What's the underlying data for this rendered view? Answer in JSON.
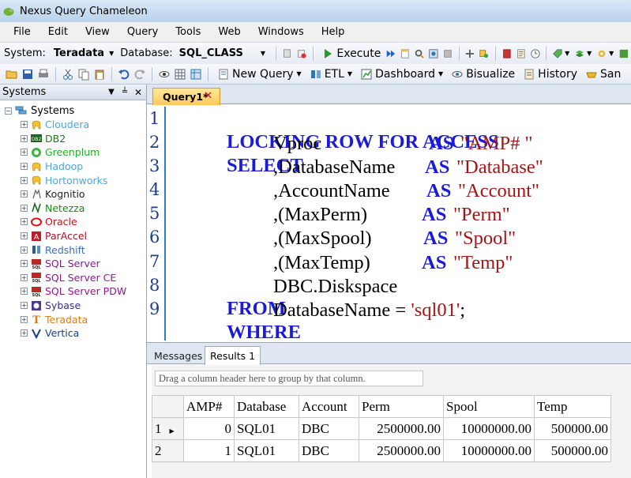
{
  "window": {
    "title": "Nexus Query Chameleon"
  },
  "menu": [
    "File",
    "Edit",
    "View",
    "Query",
    "Tools",
    "Web",
    "Windows",
    "Help"
  ],
  "toolbar1": {
    "system_label": "System:",
    "system_value": "Teradata",
    "database_label": "Database:",
    "database_value": "SQL_CLASS",
    "execute_label": "Execute"
  },
  "toolbar2": {
    "new_query_label": "New Query",
    "etl_label": "ETL",
    "dashboard_label": "Dashboard",
    "bisualize_label": "Bisualize",
    "history_label": "History",
    "san_label": "San"
  },
  "systems_panel": {
    "header": "Systems",
    "root": "Systems",
    "items": [
      {
        "label": "Cloudera",
        "color": "#4aa7d8",
        "icon": "elephant-icon"
      },
      {
        "label": "DB2",
        "color": "#1a7a1a",
        "icon": "db2-icon"
      },
      {
        "label": "Greenplum",
        "color": "#22b022",
        "icon": "greenplum-icon"
      },
      {
        "label": "Hadoop",
        "color": "#4aa7d8",
        "icon": "elephant-icon"
      },
      {
        "label": "Hortonworks",
        "color": "#4aa7d8",
        "icon": "elephant-icon"
      },
      {
        "label": "Kognitio",
        "color": "#222222",
        "icon": "kognitio-icon"
      },
      {
        "label": "Netezza",
        "color": "#1a8a1a",
        "icon": "netezza-icon"
      },
      {
        "label": "Oracle",
        "color": "#cc1111",
        "icon": "oracle-icon"
      },
      {
        "label": "ParAccel",
        "color": "#b01020",
        "icon": "paraccel-icon"
      },
      {
        "label": "Redshift",
        "color": "#3a6fb0",
        "icon": "redshift-icon"
      },
      {
        "label": "SQL Server",
        "color": "#8b1a8b",
        "icon": "sql-server-icon"
      },
      {
        "label": "SQL Server CE",
        "color": "#8b1a8b",
        "icon": "sql-server-icon"
      },
      {
        "label": "SQL Server PDW",
        "color": "#8b1a8b",
        "icon": "sql-server-icon"
      },
      {
        "label": "Sybase",
        "color": "#3a2a8a",
        "icon": "sybase-icon"
      },
      {
        "label": "Teradata",
        "color": "#e07a10",
        "icon": "teradata-icon"
      },
      {
        "label": "Vertica",
        "color": "#1a3a8a",
        "icon": "vertica-icon"
      }
    ]
  },
  "editor": {
    "tab_label": "Query1*",
    "tab_close": "✕",
    "line_numbers": [
      "1",
      "2",
      "3",
      "4",
      "5",
      "6",
      "7",
      "8",
      "9"
    ],
    "lines": {
      "l1_kw": "LOCKING ROW FOR ACCESS",
      "l2_kw": "SELECT",
      "l2_col": "Vproc",
      "l2_as": "AS",
      "l2_alias": "\"AMP# \"",
      "l3_col": ",DatabaseName",
      "l3_as": "AS",
      "l3_alias": "\"Database\"",
      "l4_col": ",AccountName",
      "l4_as": "AS",
      "l4_alias": "\"Account\"",
      "l5_col": ",(MaxPerm)",
      "l5_as": "AS",
      "l5_alias": "\"Perm\"",
      "l6_col": ",(MaxSpool)",
      "l6_as": "AS",
      "l6_alias": "\"Spool\"",
      "l7_col": ",(MaxTemp)",
      "l7_as": "AS",
      "l7_alias": "\"Temp\"",
      "l8_kw": "FROM",
      "l8_rest": "DBC.Diskspace",
      "l9_kw": "WHERE",
      "l9_rest": "DatabaseName = ",
      "l9_str": "'sql01'",
      "l9_end": ";"
    }
  },
  "results": {
    "tab_messages": "Messages",
    "tab_results": "Results 1",
    "group_hint": "Drag a column header here to group by that column.",
    "columns": [
      "AMP#",
      "Database",
      "Account",
      "Perm",
      "Spool",
      "Temp"
    ],
    "rows": [
      {
        "num": "1",
        "cells": [
          "0",
          "SQL01",
          "DBC",
          "2500000.00",
          "10000000.00",
          "500000.00"
        ]
      },
      {
        "num": "2",
        "cells": [
          "1",
          "SQL01",
          "DBC",
          "2500000.00",
          "10000000.00",
          "500000.00"
        ]
      }
    ]
  }
}
